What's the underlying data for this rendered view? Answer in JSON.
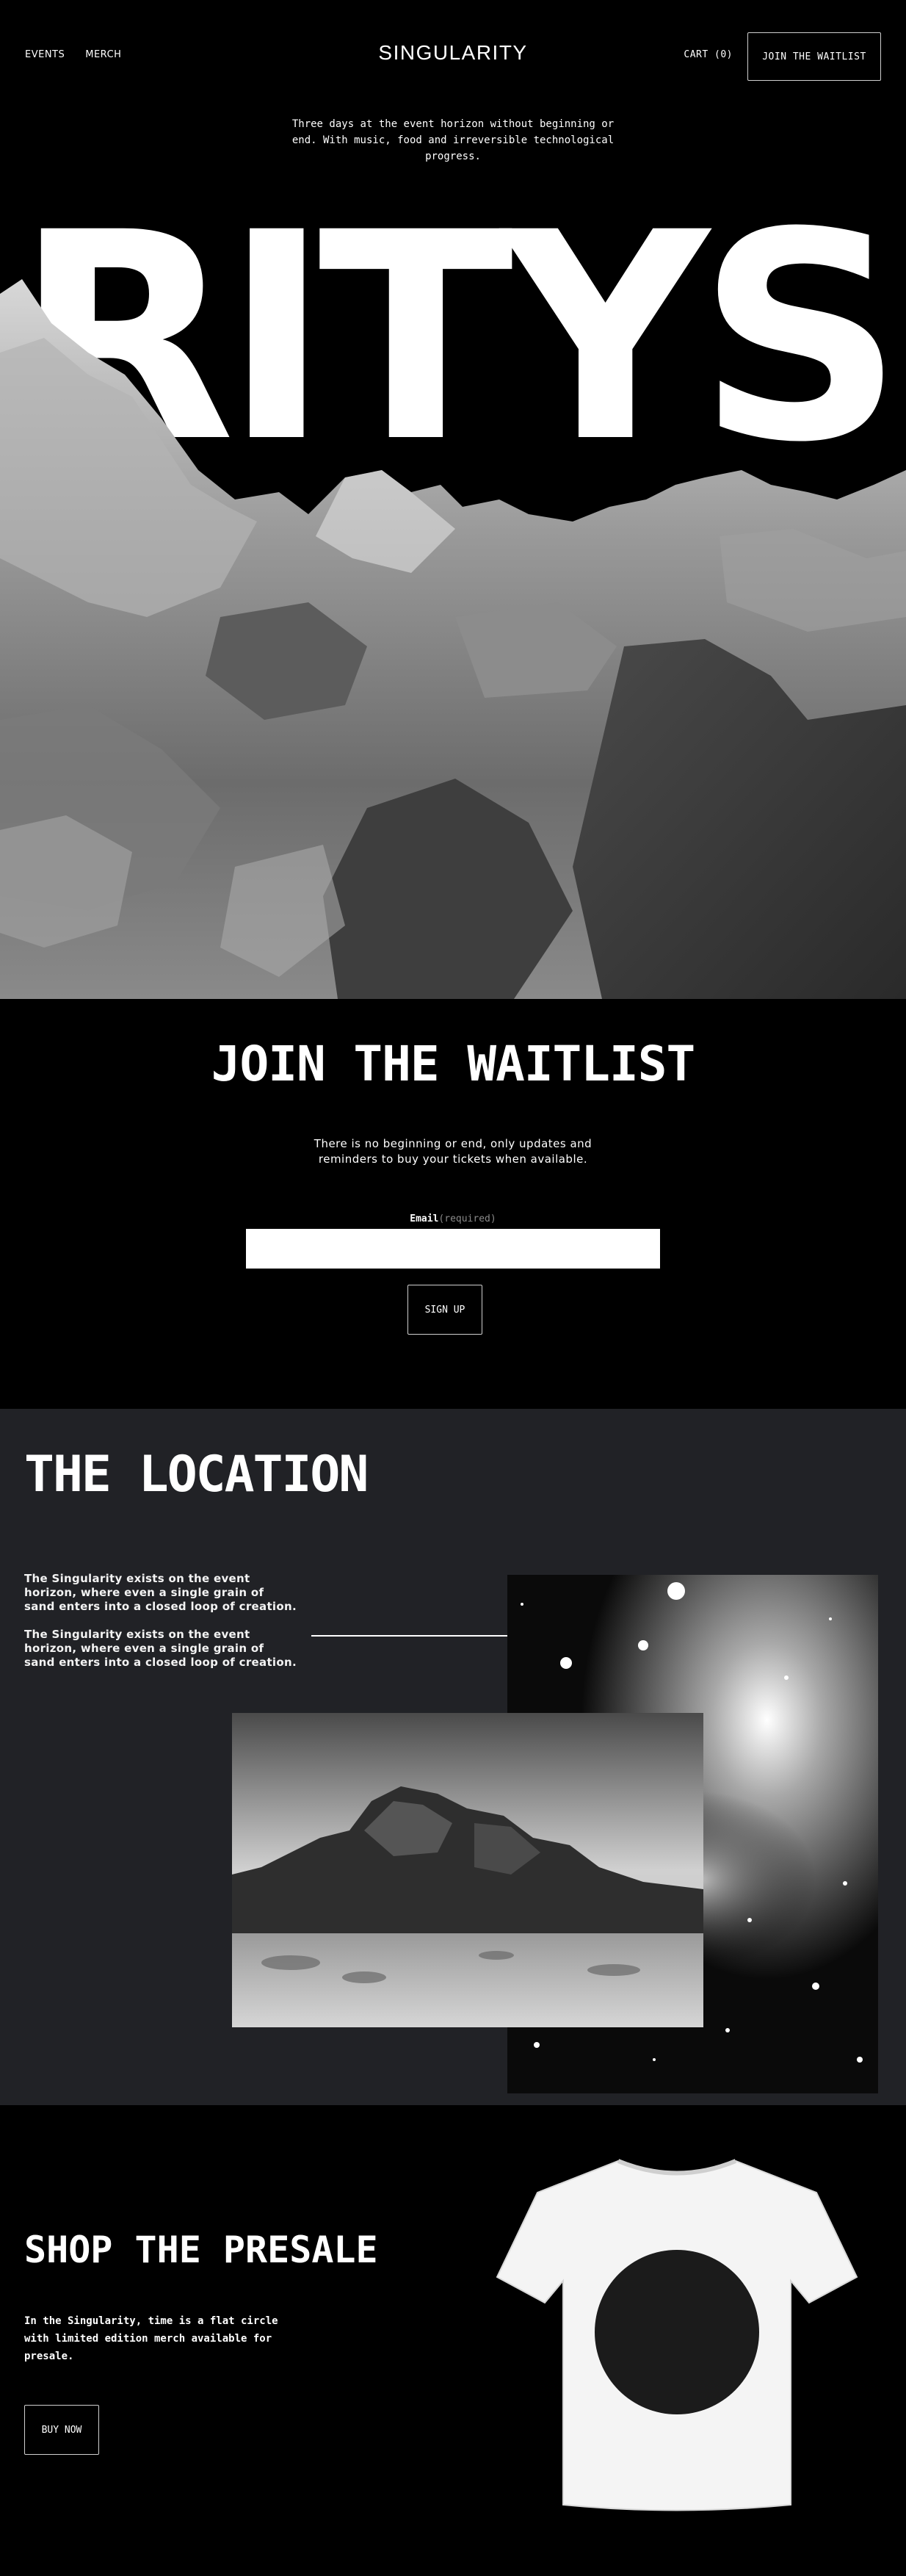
{
  "nav": {
    "events": "EVENTS",
    "merch": "MERCH",
    "logo": "SINGULARITY",
    "cart": "CART (0)",
    "join_button": "JOIN THE WAITLIST"
  },
  "hero": {
    "tagline": "Three days at the event horizon without beginning or end. With music, food and irreversible technological progress.",
    "big_word": "RITYS"
  },
  "waitlist": {
    "title": "JOIN THE WAITLIST",
    "text": "There is no beginning or end, only updates and reminders to buy your tickets when available.",
    "email_label": "Email",
    "email_required": "(required)",
    "email_value": "",
    "signup_button": "SIGN UP"
  },
  "location": {
    "title": "THE LOCATION",
    "para1": "The Singularity exists on the event horizon, where even a single grain of sand enters into a closed loop of creation.",
    "para2": "The Singularity exists on the event horizon, where even a single grain of sand enters into a closed loop of creation."
  },
  "shop": {
    "title": "SHOP THE PRESALE",
    "text": "In the Singularity, time is a flat circle with limited edition merch available for presale.",
    "buy_button": "BUY NOW"
  },
  "colors": {
    "background": "#000000",
    "location_bg": "#212226",
    "text": "#ffffff"
  }
}
